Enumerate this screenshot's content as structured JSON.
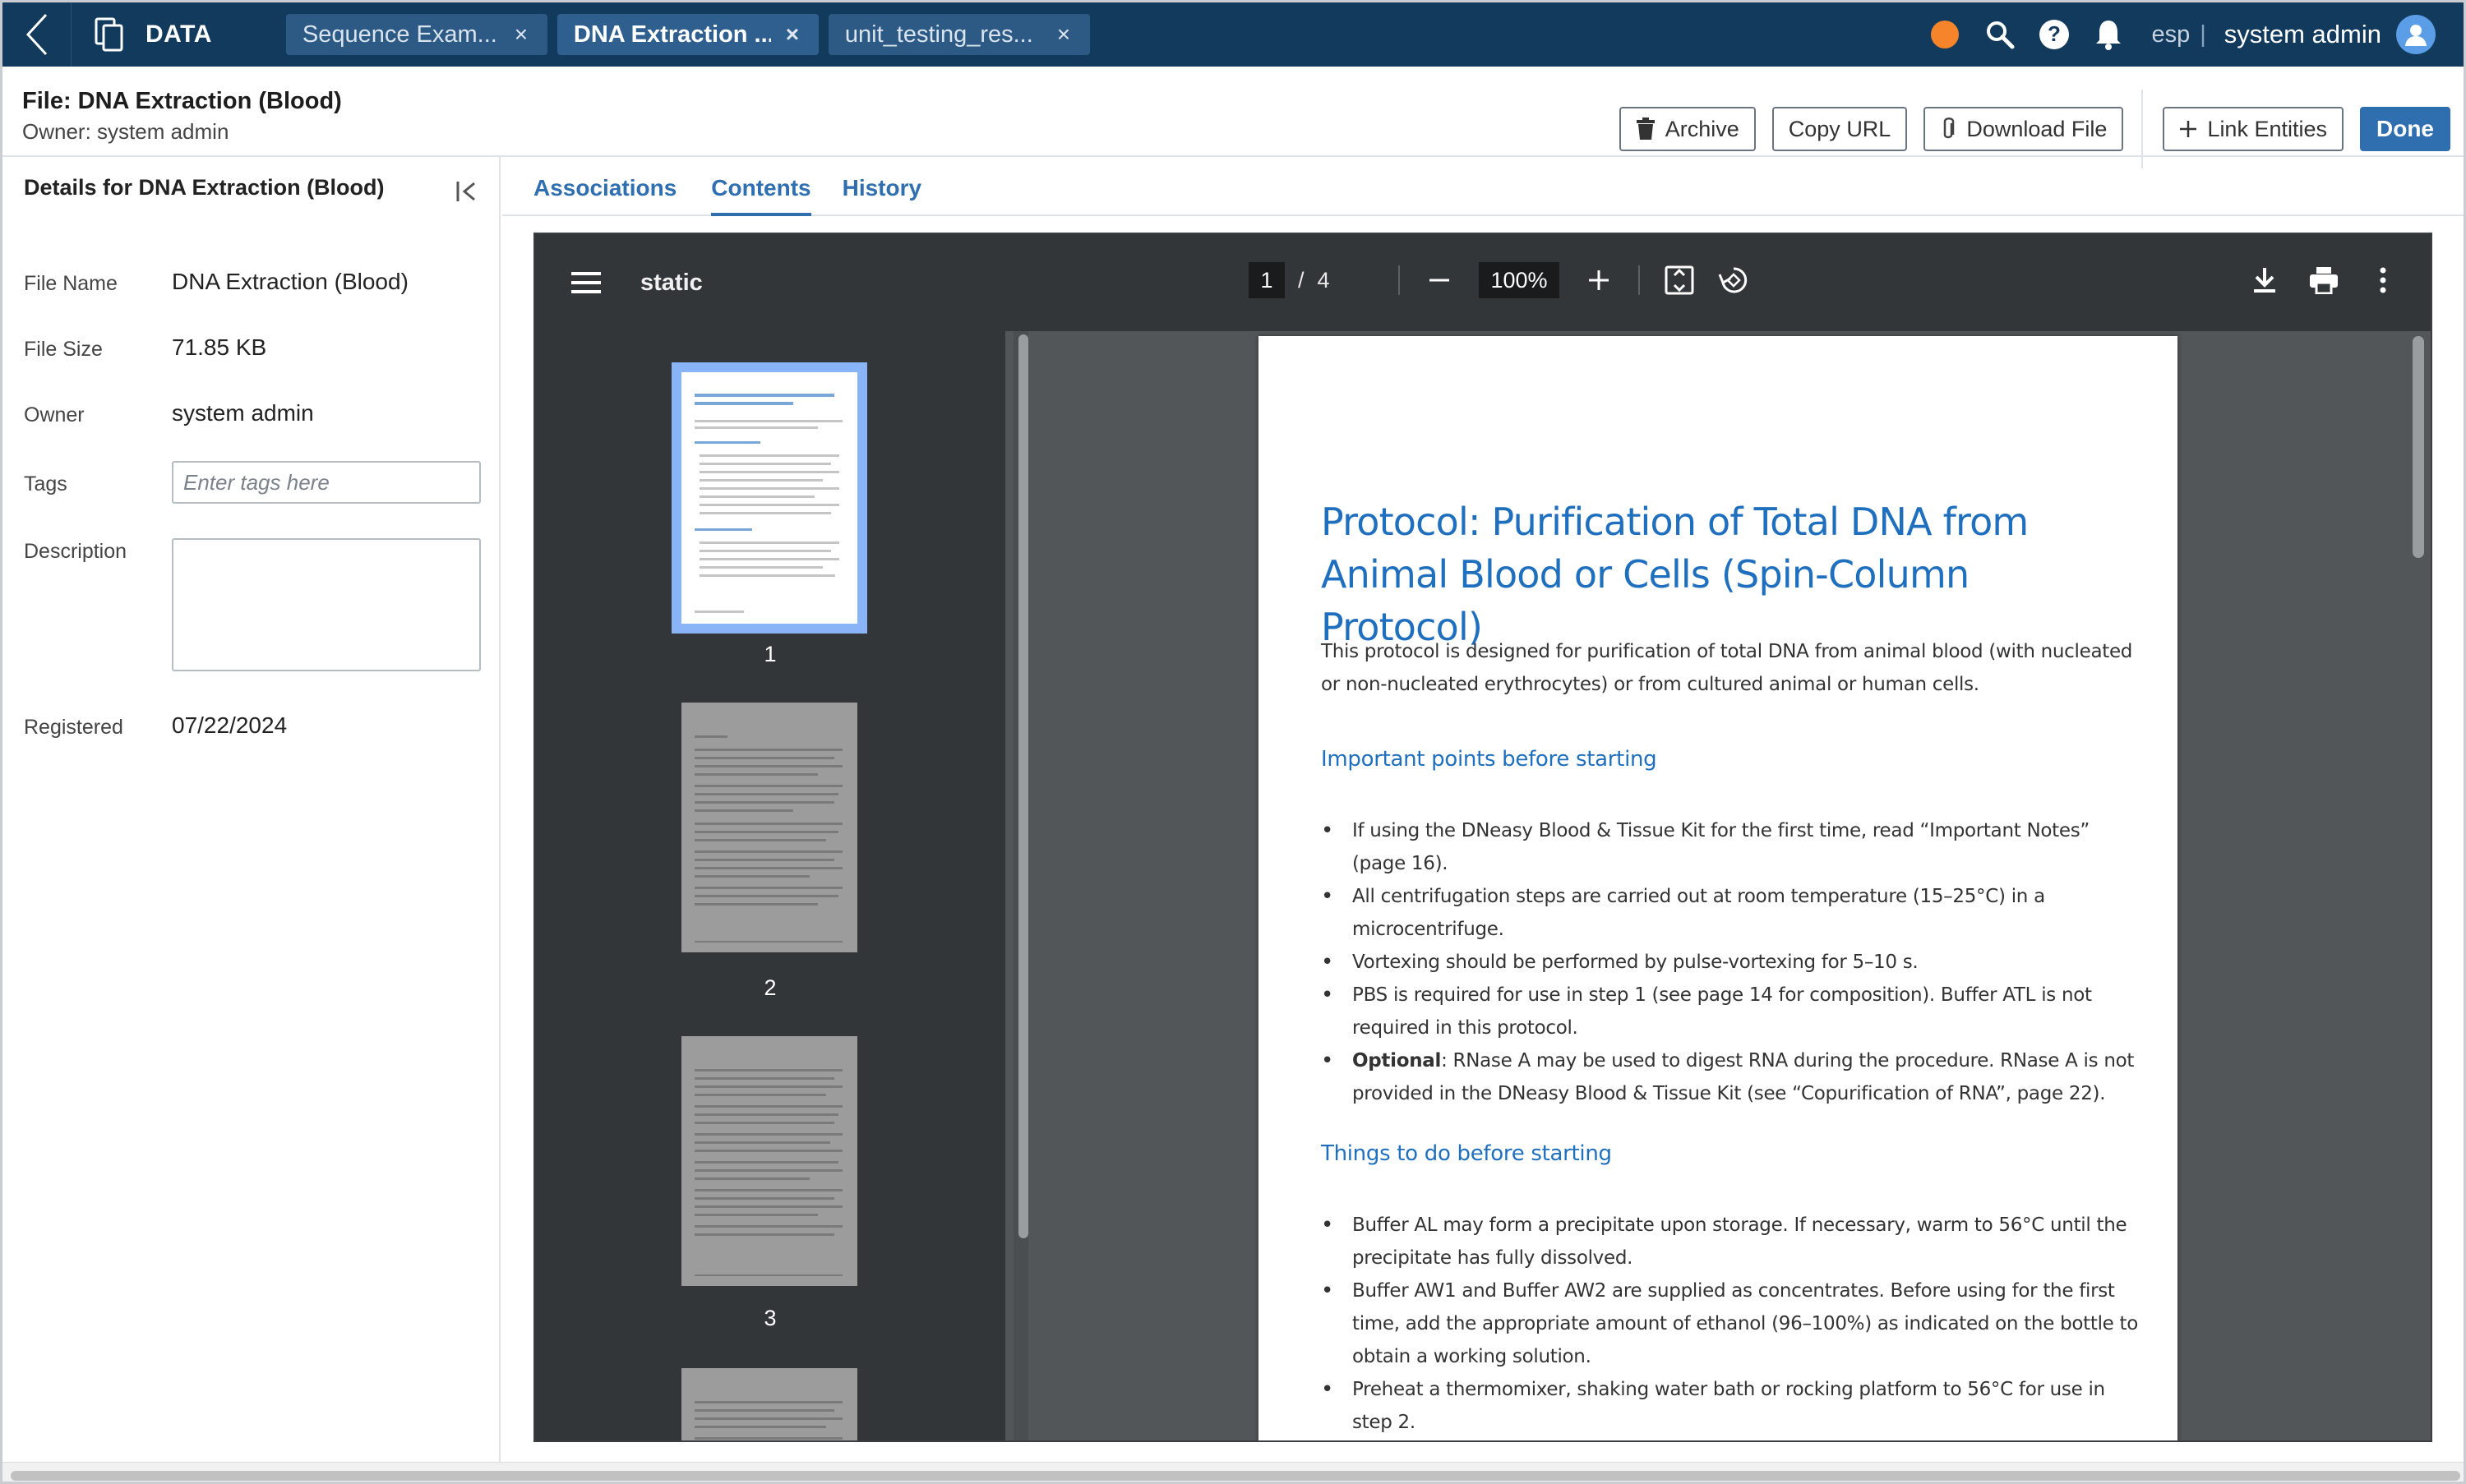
{
  "topbar": {
    "app_name": "DATA",
    "tabs": [
      {
        "label": "Sequence Exam...",
        "active": false
      },
      {
        "label": "DNA Extraction ...",
        "active": true
      },
      {
        "label": "unit_testing_res...",
        "active": false
      }
    ],
    "close_glyph": "×",
    "tenant": "esp",
    "separator": "|",
    "user": "system admin",
    "status_color": "#f5842b"
  },
  "header": {
    "title": "File: DNA Extraction (Blood)",
    "owner": "Owner: system admin",
    "buttons": {
      "archive": "Archive",
      "copy_url": "Copy URL",
      "download": "Download File",
      "link": "Link Entities",
      "done": "Done"
    }
  },
  "details": {
    "title": "Details for DNA Extraction (Blood)",
    "fields": {
      "file_name_label": "File Name",
      "file_name": "DNA Extraction (Blood)",
      "file_size_label": "File Size",
      "file_size": "71.85 KB",
      "owner_label": "Owner",
      "owner": "system admin",
      "tags_label": "Tags",
      "tags_placeholder": "Enter tags here",
      "description_label": "Description",
      "registered_label": "Registered",
      "registered": "07/22/2024"
    }
  },
  "content_tabs": [
    {
      "label": "Associations",
      "active": false
    },
    {
      "label": "Contents",
      "active": true
    },
    {
      "label": "History",
      "active": false
    }
  ],
  "pdf": {
    "name": "static",
    "current_page": "1",
    "page_sep": "/",
    "total_pages": "4",
    "zoom": "100%",
    "thumb_numbers": [
      "1",
      "2",
      "3"
    ],
    "document": {
      "title": "Protocol: Purification of Total DNA from Animal Blood or Cells (Spin-Column Protocol)",
      "intro": "This protocol is designed for purification of total DNA from animal blood (with nucleated or non-nucleated erythrocytes) or from cultured animal or human cells.",
      "section1_title": "Important points before starting",
      "section1_items": [
        "If using the DNeasy Blood & Tissue Kit for the first time, read “Important Notes” (page 16).",
        "All centrifugation steps are carried out at room temperature (15–25°C) in a microcentrifuge.",
        "Vortexing should be performed by pulse-vortexing for 5–10 s.",
        "PBS is required for use in step 1 (see page 14 for composition). Buffer ATL is not required in this protocol."
      ],
      "optional_label": "Optional",
      "optional_text": ": RNase A may be used to digest RNA during the procedure. RNase A is not provided in the DNeasy Blood & Tissue Kit (see “Copurification of RNA”, page 22).",
      "section2_title": "Things to do before starting",
      "section2_items": [
        "Buffer AL may form a precipitate upon storage. If necessary, warm to 56°C until the precipitate has fully dissolved.",
        "Buffer AW1 and Buffer AW2 are supplied as concentrates. Before using for the first time, add the appropriate amount of ethanol (96–100%) as indicated on the bottle to obtain a working solution.",
        "Preheat a thermomixer, shaking water bath or rocking platform to 56°C for use in step 2."
      ]
    }
  },
  "colors": {
    "topbar_bg": "#123a5c",
    "accent": "#2f6fb0",
    "doc_heading": "#1f6fbf"
  }
}
